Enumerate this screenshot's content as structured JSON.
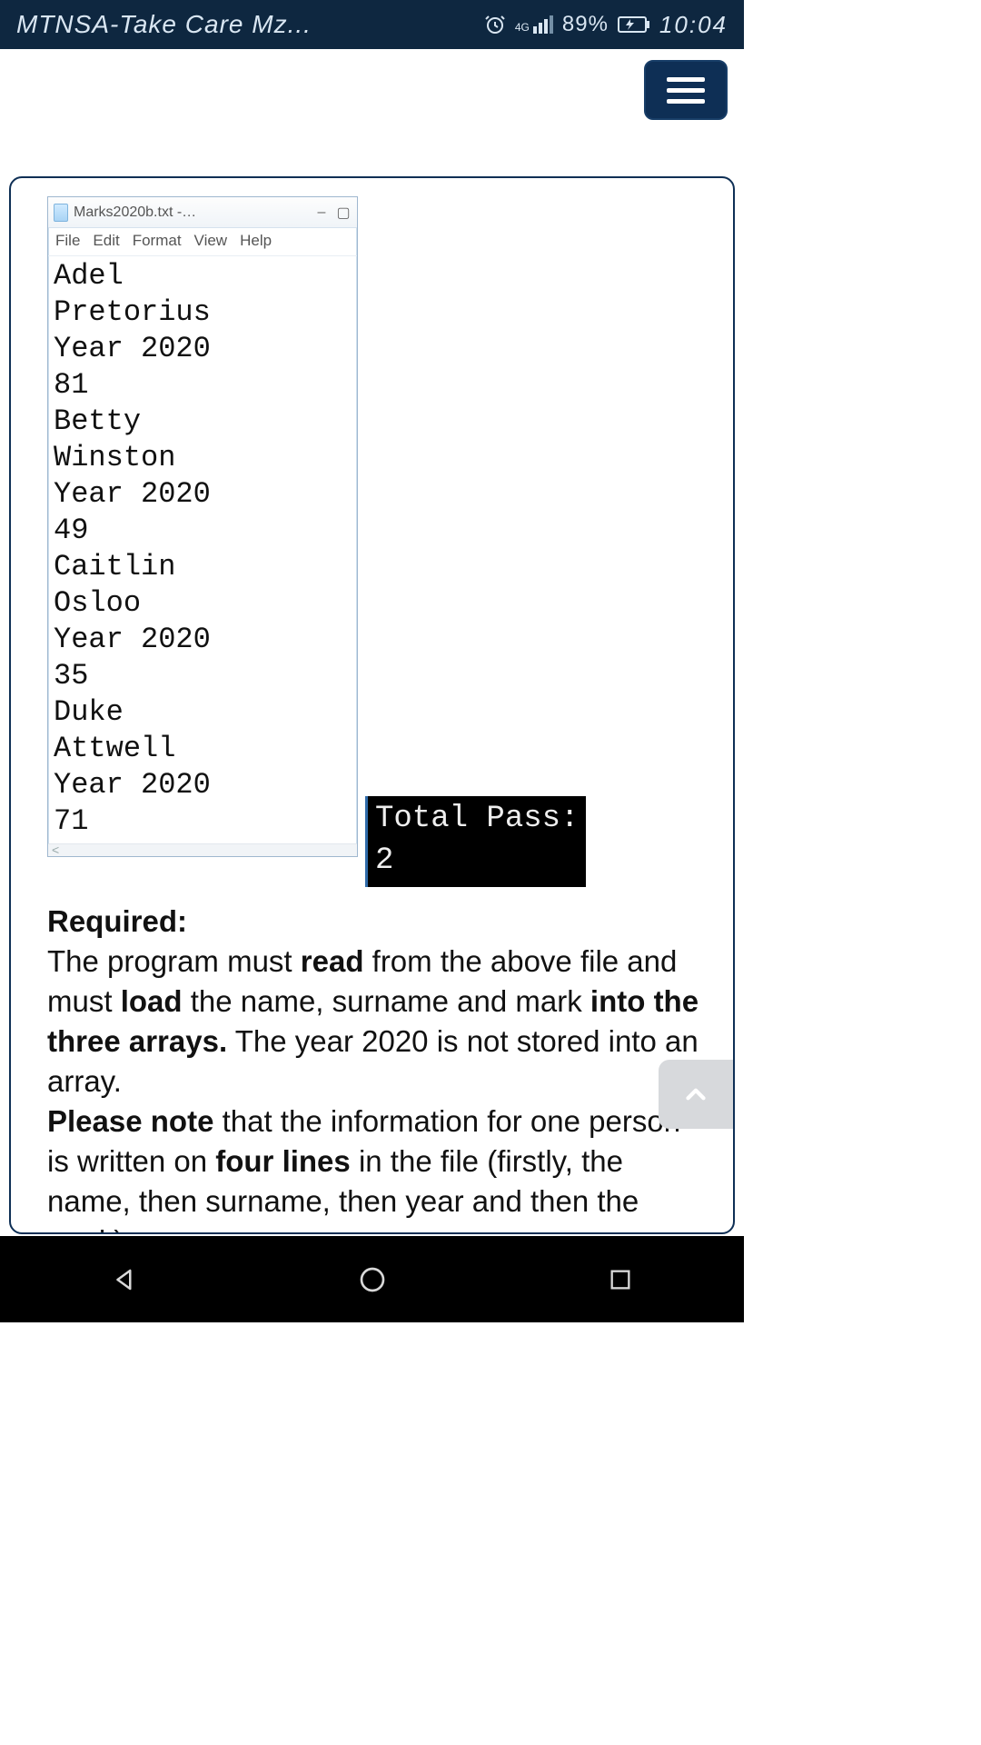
{
  "statusbar": {
    "title": "MTNSA-Take Care Mz...",
    "network_label": "4G",
    "battery_pct": "89%",
    "clock": "10:04"
  },
  "notepad": {
    "filename": "Marks2020b.txt -…",
    "menus": [
      "File",
      "Edit",
      "Format",
      "View",
      "Help"
    ],
    "lines": [
      "Adel",
      "Pretorius",
      "Year 2020",
      "81",
      "Betty",
      "Winston",
      "Year 2020",
      "49",
      "Caitlin",
      "Osloo",
      "Year 2020",
      "35",
      "Duke",
      "Attwell",
      "Year 2020",
      "71"
    ]
  },
  "console": {
    "line1": "Total Pass:",
    "line2": "2"
  },
  "instructions": {
    "required_label": "Required:",
    "p1a": "The program must ",
    "p1b": "read",
    "p1c": " from the above file and must ",
    "p1d": "load",
    "p1e": " the name, surname and mark ",
    "p1f": "into the three arrays.",
    "p1g": " The year 2020 is not stored into an array.",
    "p2a": "Please note",
    "p2b": " that the information for one person is written on ",
    "p2c": "four lines",
    "p2d": " in the file (firstly, the name, then surname, then year and then the mark)"
  }
}
